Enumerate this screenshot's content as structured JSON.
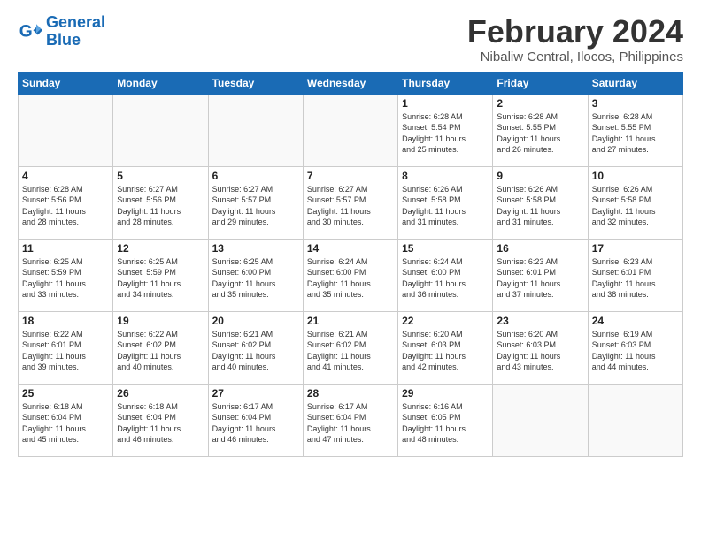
{
  "logo": {
    "line1": "General",
    "line2": "Blue"
  },
  "title": {
    "month_year": "February 2024",
    "location": "Nibaliw Central, Ilocos, Philippines"
  },
  "weekdays": [
    "Sunday",
    "Monday",
    "Tuesday",
    "Wednesday",
    "Thursday",
    "Friday",
    "Saturday"
  ],
  "weeks": [
    [
      {
        "day": "",
        "info": ""
      },
      {
        "day": "",
        "info": ""
      },
      {
        "day": "",
        "info": ""
      },
      {
        "day": "",
        "info": ""
      },
      {
        "day": "1",
        "info": "Sunrise: 6:28 AM\nSunset: 5:54 PM\nDaylight: 11 hours\nand 25 minutes."
      },
      {
        "day": "2",
        "info": "Sunrise: 6:28 AM\nSunset: 5:55 PM\nDaylight: 11 hours\nand 26 minutes."
      },
      {
        "day": "3",
        "info": "Sunrise: 6:28 AM\nSunset: 5:55 PM\nDaylight: 11 hours\nand 27 minutes."
      }
    ],
    [
      {
        "day": "4",
        "info": "Sunrise: 6:28 AM\nSunset: 5:56 PM\nDaylight: 11 hours\nand 28 minutes."
      },
      {
        "day": "5",
        "info": "Sunrise: 6:27 AM\nSunset: 5:56 PM\nDaylight: 11 hours\nand 28 minutes."
      },
      {
        "day": "6",
        "info": "Sunrise: 6:27 AM\nSunset: 5:57 PM\nDaylight: 11 hours\nand 29 minutes."
      },
      {
        "day": "7",
        "info": "Sunrise: 6:27 AM\nSunset: 5:57 PM\nDaylight: 11 hours\nand 30 minutes."
      },
      {
        "day": "8",
        "info": "Sunrise: 6:26 AM\nSunset: 5:58 PM\nDaylight: 11 hours\nand 31 minutes."
      },
      {
        "day": "9",
        "info": "Sunrise: 6:26 AM\nSunset: 5:58 PM\nDaylight: 11 hours\nand 31 minutes."
      },
      {
        "day": "10",
        "info": "Sunrise: 6:26 AM\nSunset: 5:58 PM\nDaylight: 11 hours\nand 32 minutes."
      }
    ],
    [
      {
        "day": "11",
        "info": "Sunrise: 6:25 AM\nSunset: 5:59 PM\nDaylight: 11 hours\nand 33 minutes."
      },
      {
        "day": "12",
        "info": "Sunrise: 6:25 AM\nSunset: 5:59 PM\nDaylight: 11 hours\nand 34 minutes."
      },
      {
        "day": "13",
        "info": "Sunrise: 6:25 AM\nSunset: 6:00 PM\nDaylight: 11 hours\nand 35 minutes."
      },
      {
        "day": "14",
        "info": "Sunrise: 6:24 AM\nSunset: 6:00 PM\nDaylight: 11 hours\nand 35 minutes."
      },
      {
        "day": "15",
        "info": "Sunrise: 6:24 AM\nSunset: 6:00 PM\nDaylight: 11 hours\nand 36 minutes."
      },
      {
        "day": "16",
        "info": "Sunrise: 6:23 AM\nSunset: 6:01 PM\nDaylight: 11 hours\nand 37 minutes."
      },
      {
        "day": "17",
        "info": "Sunrise: 6:23 AM\nSunset: 6:01 PM\nDaylight: 11 hours\nand 38 minutes."
      }
    ],
    [
      {
        "day": "18",
        "info": "Sunrise: 6:22 AM\nSunset: 6:01 PM\nDaylight: 11 hours\nand 39 minutes."
      },
      {
        "day": "19",
        "info": "Sunrise: 6:22 AM\nSunset: 6:02 PM\nDaylight: 11 hours\nand 40 minutes."
      },
      {
        "day": "20",
        "info": "Sunrise: 6:21 AM\nSunset: 6:02 PM\nDaylight: 11 hours\nand 40 minutes."
      },
      {
        "day": "21",
        "info": "Sunrise: 6:21 AM\nSunset: 6:02 PM\nDaylight: 11 hours\nand 41 minutes."
      },
      {
        "day": "22",
        "info": "Sunrise: 6:20 AM\nSunset: 6:03 PM\nDaylight: 11 hours\nand 42 minutes."
      },
      {
        "day": "23",
        "info": "Sunrise: 6:20 AM\nSunset: 6:03 PM\nDaylight: 11 hours\nand 43 minutes."
      },
      {
        "day": "24",
        "info": "Sunrise: 6:19 AM\nSunset: 6:03 PM\nDaylight: 11 hours\nand 44 minutes."
      }
    ],
    [
      {
        "day": "25",
        "info": "Sunrise: 6:18 AM\nSunset: 6:04 PM\nDaylight: 11 hours\nand 45 minutes."
      },
      {
        "day": "26",
        "info": "Sunrise: 6:18 AM\nSunset: 6:04 PM\nDaylight: 11 hours\nand 46 minutes."
      },
      {
        "day": "27",
        "info": "Sunrise: 6:17 AM\nSunset: 6:04 PM\nDaylight: 11 hours\nand 46 minutes."
      },
      {
        "day": "28",
        "info": "Sunrise: 6:17 AM\nSunset: 6:04 PM\nDaylight: 11 hours\nand 47 minutes."
      },
      {
        "day": "29",
        "info": "Sunrise: 6:16 AM\nSunset: 6:05 PM\nDaylight: 11 hours\nand 48 minutes."
      },
      {
        "day": "",
        "info": ""
      },
      {
        "day": "",
        "info": ""
      }
    ]
  ]
}
